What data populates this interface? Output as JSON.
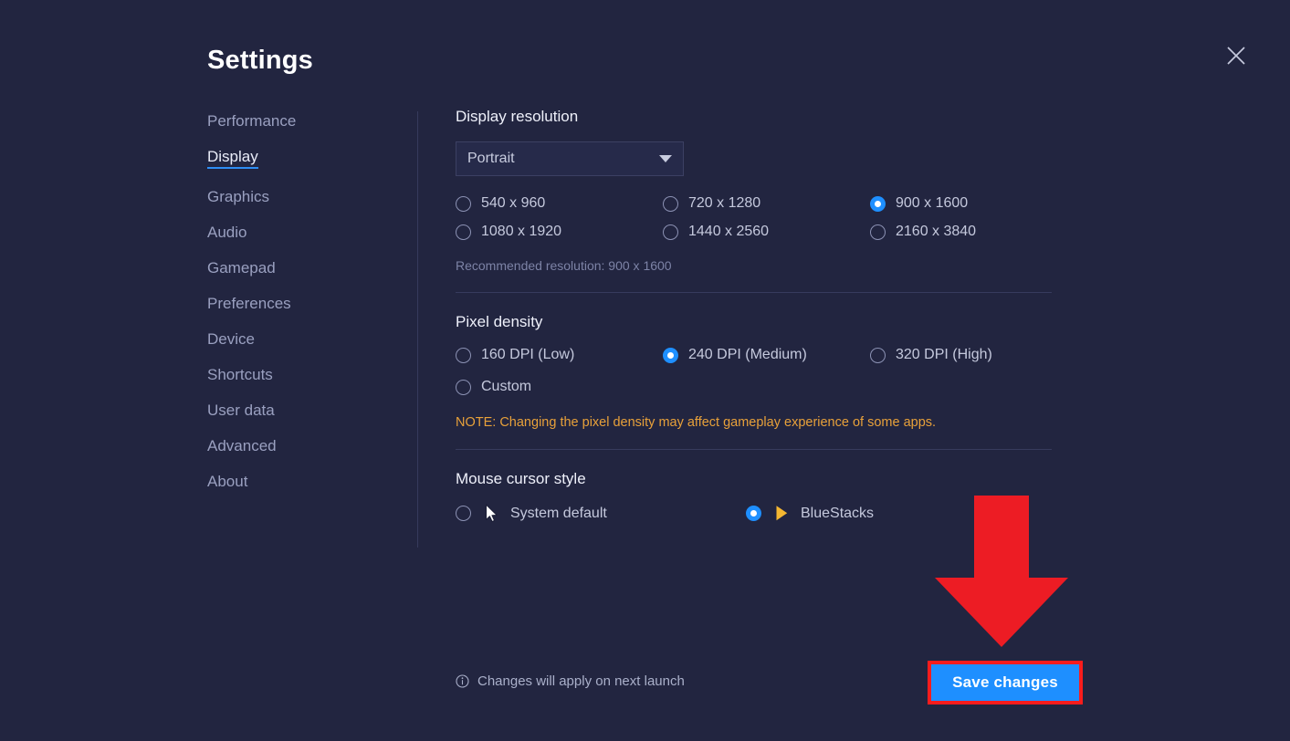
{
  "window": {
    "title": "Settings",
    "close_icon": "close-x-icon",
    "background_color": "#222540",
    "accent_color": "#1e8fff"
  },
  "sidebar": {
    "items": [
      {
        "label": "Performance",
        "active": false
      },
      {
        "label": "Display",
        "active": true
      },
      {
        "label": "Graphics",
        "active": false
      },
      {
        "label": "Audio",
        "active": false
      },
      {
        "label": "Gamepad",
        "active": false
      },
      {
        "label": "Preferences",
        "active": false
      },
      {
        "label": "Device",
        "active": false
      },
      {
        "label": "Shortcuts",
        "active": false
      },
      {
        "label": "User data",
        "active": false
      },
      {
        "label": "Advanced",
        "active": false
      },
      {
        "label": "About",
        "active": false
      }
    ]
  },
  "display_resolution": {
    "title": "Display resolution",
    "orientation_select": {
      "value": "Portrait",
      "caret_icon": "chevron-down-icon"
    },
    "options": [
      {
        "label": "540 x 960",
        "selected": false
      },
      {
        "label": "720 x 1280",
        "selected": false
      },
      {
        "label": "900 x 1600",
        "selected": true
      },
      {
        "label": "1080 x 1920",
        "selected": false
      },
      {
        "label": "1440 x 2560",
        "selected": false
      },
      {
        "label": "2160 x 3840",
        "selected": false
      }
    ],
    "recommended": "Recommended resolution: 900 x 1600"
  },
  "pixel_density": {
    "title": "Pixel density",
    "options": [
      {
        "label": "160 DPI (Low)",
        "selected": false
      },
      {
        "label": "240 DPI (Medium)",
        "selected": true
      },
      {
        "label": "320 DPI (High)",
        "selected": false
      },
      {
        "label": "Custom",
        "selected": false
      }
    ],
    "note": "NOTE: Changing the pixel density may affect gameplay experience of some apps.",
    "note_color": "#e8a13a"
  },
  "mouse_cursor_style": {
    "title": "Mouse cursor style",
    "options": [
      {
        "label": "System default",
        "selected": false,
        "icon": "system-cursor-icon"
      },
      {
        "label": "BlueStacks",
        "selected": true,
        "icon": "bluestacks-cursor-icon"
      }
    ]
  },
  "footer": {
    "info_icon": "info-circle-icon",
    "note": "Changes will apply on next launch",
    "save_label": "Save changes",
    "save_highlight_color": "#f91c1c"
  },
  "annotation": {
    "arrow_icon": "down-arrow-annotation",
    "arrow_color": "#ed1c24"
  }
}
